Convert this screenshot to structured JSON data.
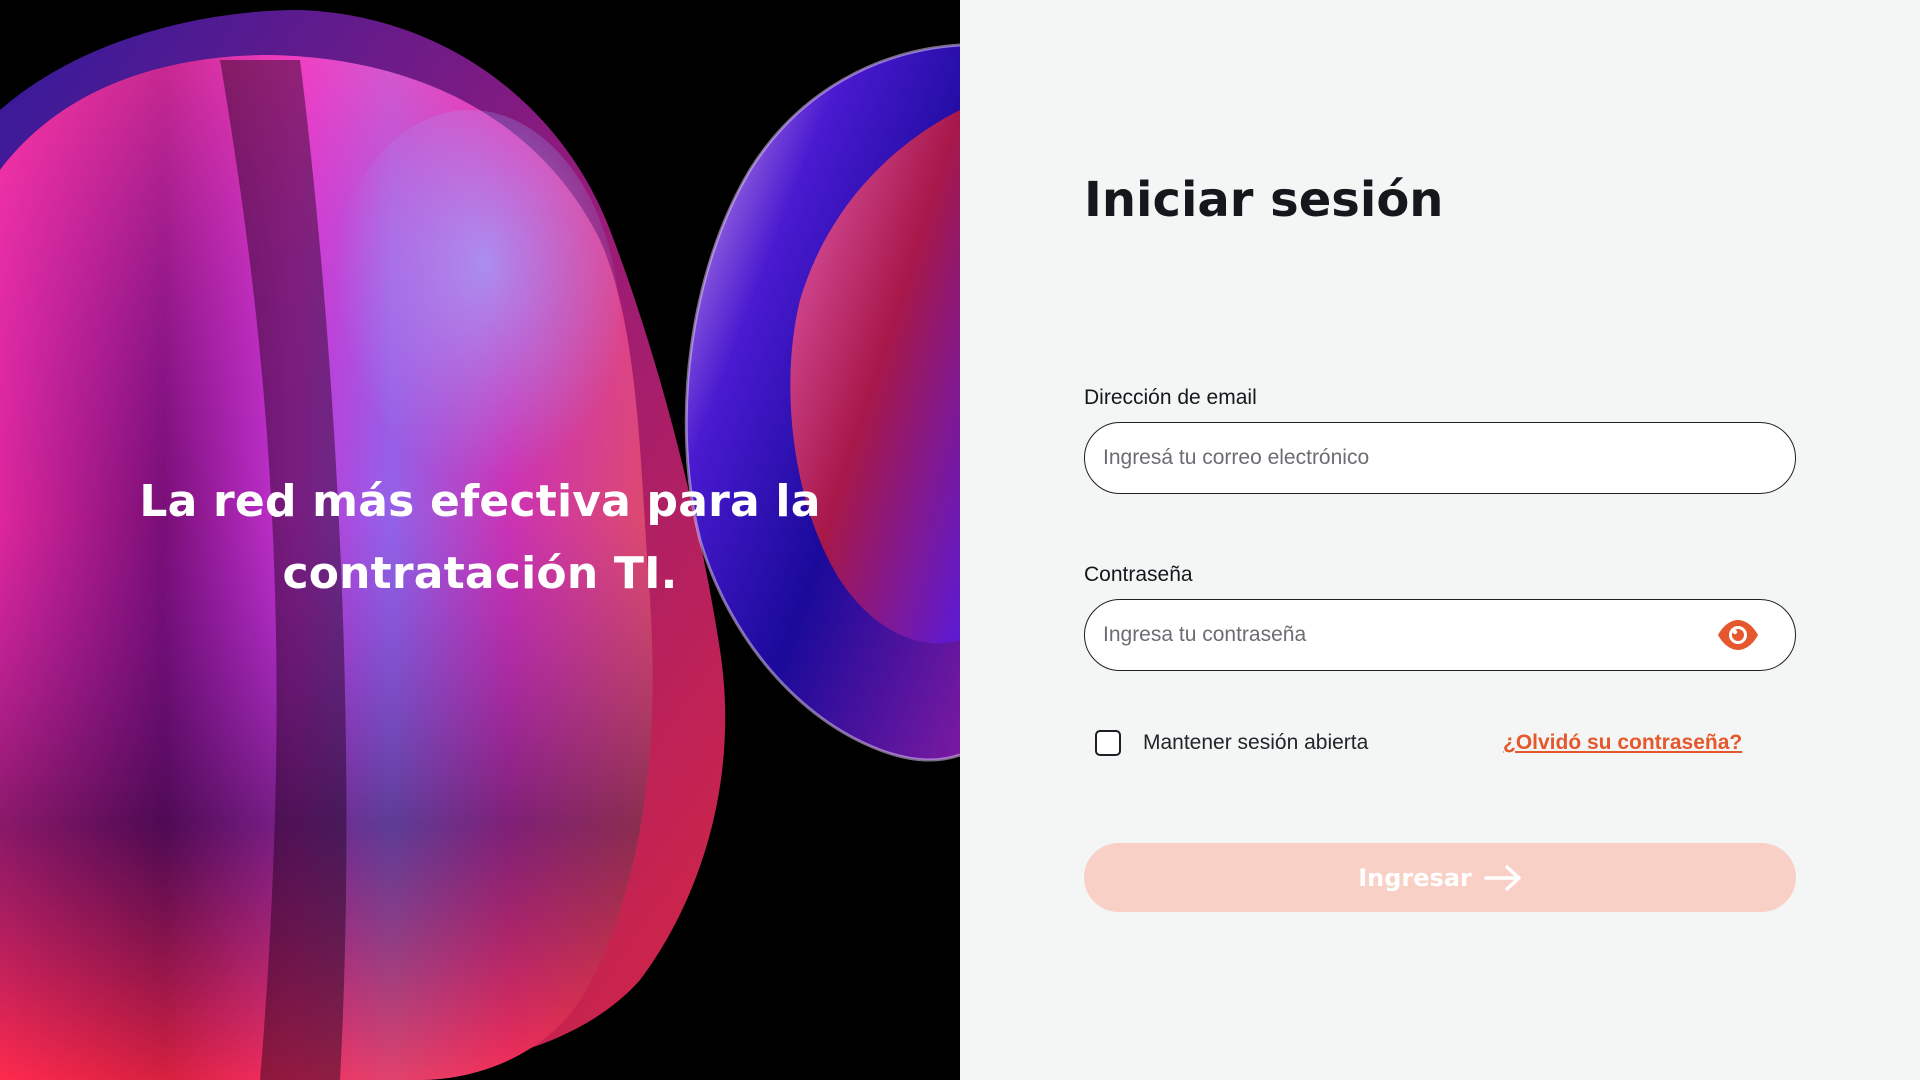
{
  "hero": {
    "tagline_line1": "La red más efectiva para la",
    "tagline_line2": "contratación TI."
  },
  "login": {
    "title": "Iniciar sesión",
    "email": {
      "label": "Dirección de email",
      "placeholder": "Ingresá tu correo electrónico",
      "value": ""
    },
    "password": {
      "label": "Contraseña",
      "placeholder": "Ingresa tu contraseña",
      "value": "",
      "toggle_icon": "eye-icon"
    },
    "remember": {
      "label": "Mantener sesión abierta",
      "checked": false
    },
    "forgot_link": "¿Olvidó su contraseña?",
    "submit": {
      "label": "Ingresar",
      "icon": "arrow-right-icon"
    }
  },
  "colors": {
    "accent": "#e5582d",
    "button_disabled_bg": "#f9d0c6",
    "panel_bg": "#f4f6f5",
    "hero_bg": "#000000"
  }
}
